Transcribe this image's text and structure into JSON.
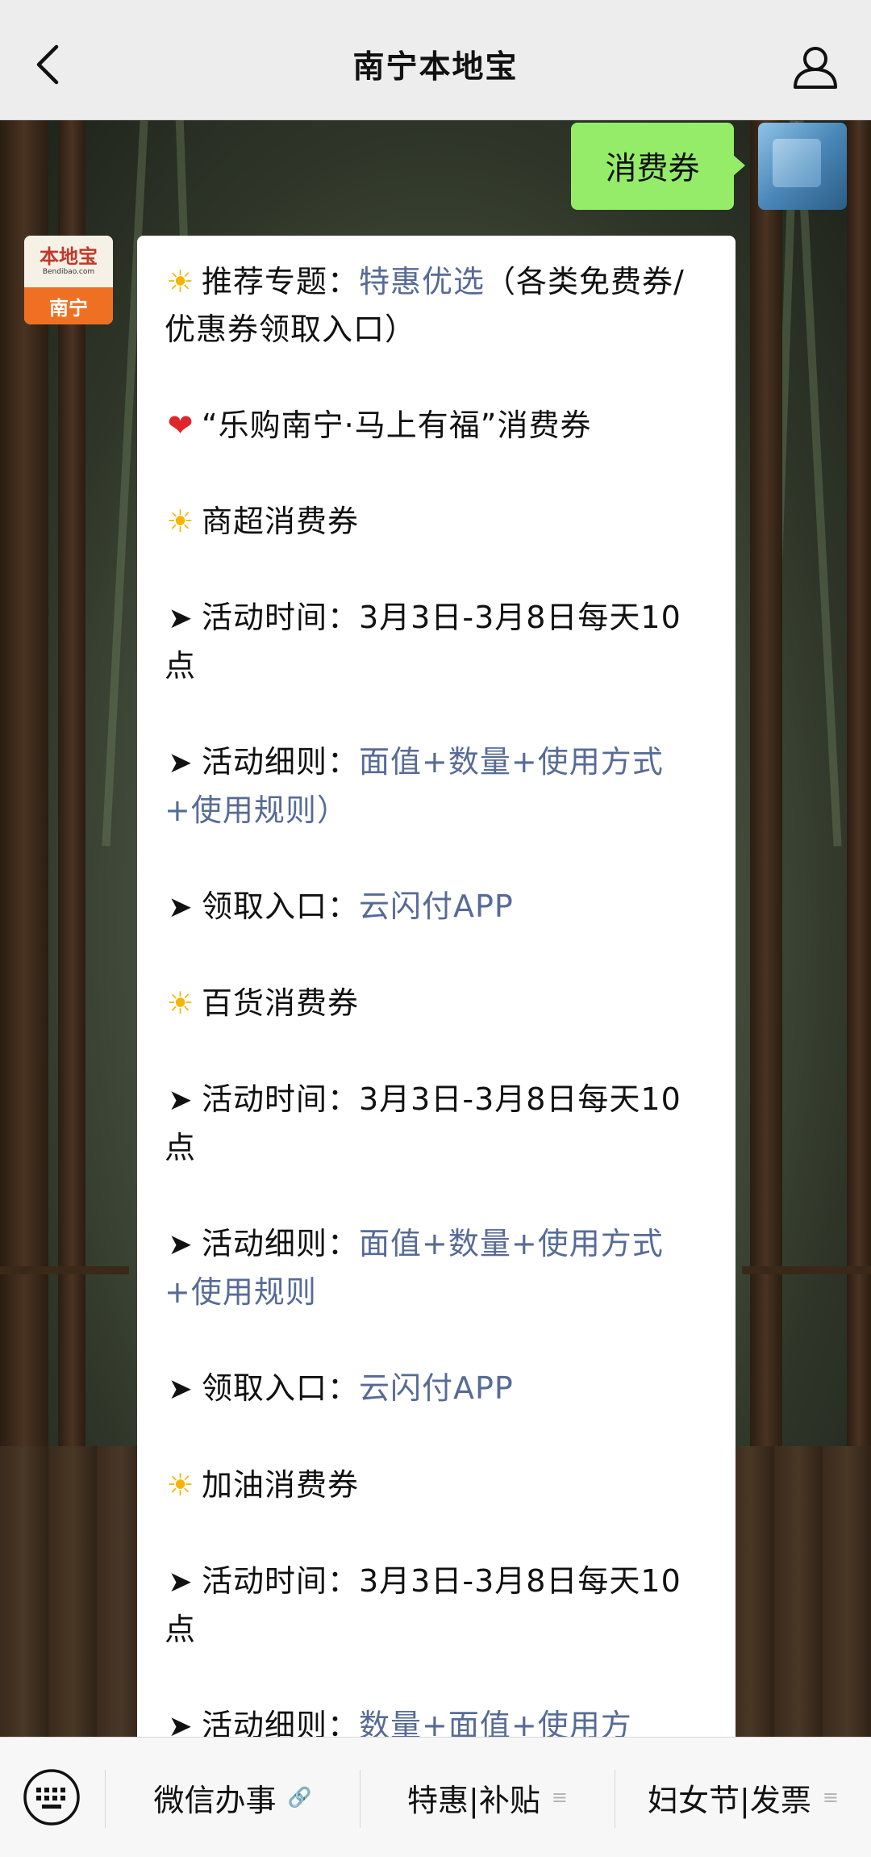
{
  "header": {
    "title": "南宁本地宝",
    "back_icon": "chevron-left-icon",
    "profile_icon": "person-icon"
  },
  "user_message": {
    "text": "消费券"
  },
  "bot_avatar": {
    "brand": "本地宝",
    "domain": "Bendibao.com",
    "city": "南宁"
  },
  "bot_message": {
    "paragraphs": [
      {
        "icon": "sun-icon",
        "prefix": "推荐专题：",
        "link": "特惠优选",
        "suffix": "（各类免费券/优惠券领取入口）"
      },
      {
        "icon": "heart-icon",
        "prefix": "“乐购南宁·马上有福”消费券",
        "link": "",
        "suffix": ""
      },
      {
        "icon": "sun-icon",
        "prefix": "商超消费券",
        "link": "",
        "suffix": ""
      },
      {
        "icon": "arrow-icon",
        "prefix": "活动时间：3月3日-3月8日每天10点",
        "link": "",
        "suffix": ""
      },
      {
        "icon": "arrow-icon",
        "prefix": "活动细则：",
        "link": "面值+数量+使用方式+使用规则）",
        "suffix": ""
      },
      {
        "icon": "arrow-icon",
        "prefix": "领取入口：",
        "link": "云闪付APP",
        "suffix": ""
      },
      {
        "icon": "sun-icon",
        "prefix": "百货消费券",
        "link": "",
        "suffix": ""
      },
      {
        "icon": "arrow-icon",
        "prefix": "活动时间：3月3日-3月8日每天10点",
        "link": "",
        "suffix": ""
      },
      {
        "icon": "arrow-icon",
        "prefix": "活动细则：",
        "link": "面值+数量+使用方式+使用规则",
        "suffix": ""
      },
      {
        "icon": "arrow-icon",
        "prefix": "领取入口：",
        "link": "云闪付APP",
        "suffix": ""
      },
      {
        "icon": "sun-icon",
        "prefix": "加油消费券",
        "link": "",
        "suffix": ""
      },
      {
        "icon": "arrow-icon",
        "prefix": "活动时间：3月3日-3月8日每天10点",
        "link": "",
        "suffix": ""
      },
      {
        "icon": "arrow-icon",
        "prefix": "活动细则：",
        "link": "数量+面值+使用方",
        "suffix": ""
      }
    ]
  },
  "menu": {
    "keyboard_icon": "keyboard-icon",
    "items": [
      {
        "label": "微信办事",
        "icon": "link-icon"
      },
      {
        "label": "特惠|补贴",
        "icon": "menu-lines-icon"
      },
      {
        "label": "妇女节|发票",
        "icon": "menu-lines-icon"
      }
    ]
  },
  "colors": {
    "header_bg": "#ededed",
    "user_bubble": "#95ec69",
    "link": "#576b95",
    "avatar_orange": "#f07023"
  }
}
